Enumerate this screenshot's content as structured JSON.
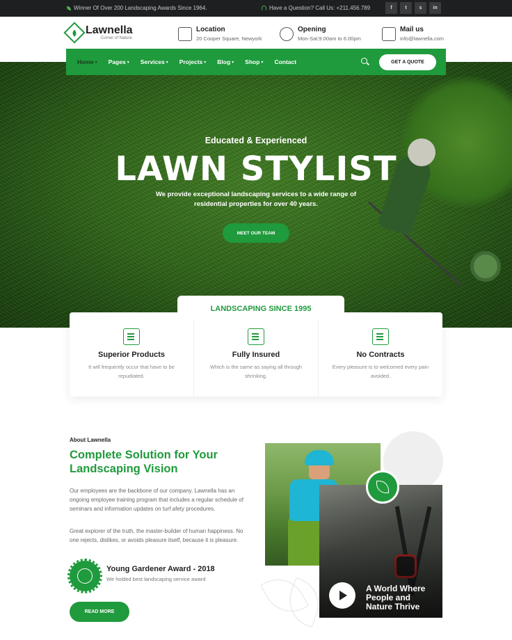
{
  "topbar": {
    "award_text": "Winner Of Over 200 Landscaping Awards Since 1964.",
    "call_text": "Have a Question? Call Us: +211.456.789",
    "socials": [
      "f",
      "t",
      "s",
      "in"
    ]
  },
  "brand": {
    "name": "Lawnella",
    "tagline": "Corner of Nature"
  },
  "header": {
    "location": {
      "title": "Location",
      "value": "20 Cooper Square, Newyork",
      "icon": "map-icon"
    },
    "opening": {
      "title": "Opening",
      "value": "Mon-Sat:9.00am to 6.00pm",
      "icon": "clock-icon"
    },
    "mail": {
      "title": "Mail us",
      "value": "info@lawnella.com",
      "icon": "mail-icon"
    }
  },
  "nav": {
    "items": [
      "Home",
      "Pages",
      "Services",
      "Projects",
      "Blog",
      "Shop",
      "Contact"
    ],
    "quote_label": "GET A QUOTE"
  },
  "hero": {
    "subtitle": "Educated & Experienced",
    "title": "LAWN STYLIST",
    "description": "We provide exceptional landscaping services to a wide range of residential properties for over 40 years.",
    "button": "MEET OUR TEAM"
  },
  "features": {
    "tab_label": "LANDSCAPING SINCE 1995",
    "items": [
      {
        "title": "Superior Products",
        "desc": "It will frequently occur that have to be repudiated.",
        "icon": "home-tools-icon"
      },
      {
        "title": "Fully Insured",
        "desc": "Which is the same as saying all through shrinking.",
        "icon": "truck-icon"
      },
      {
        "title": "No Contracts",
        "desc": "Every pleasure is to welcomed every pain avoided.",
        "icon": "certificate-icon"
      }
    ]
  },
  "about": {
    "kicker": "About Lawnella",
    "title": "Complete Solution for Your Landscaping Vision",
    "p1": "Our employees are the backbone of our company. Lawnella has an ongoing employee training program that includes a regular schedule of seminars and information updates on turf afety procedures.",
    "p2": "Great explorer of the truth, the master-builder of human happiness. No one rejects, dislikes, or avoids pleasure itself, because it is pleasure.",
    "award_title": "Young Gardener Award - 2018",
    "award_desc": "We holded best landscaping service award",
    "button": "READ MORE",
    "video_caption": "A World Where People and Nature Thrive"
  },
  "colors": {
    "accent": "#1f9a3c",
    "topbar": "#1e1f21"
  }
}
